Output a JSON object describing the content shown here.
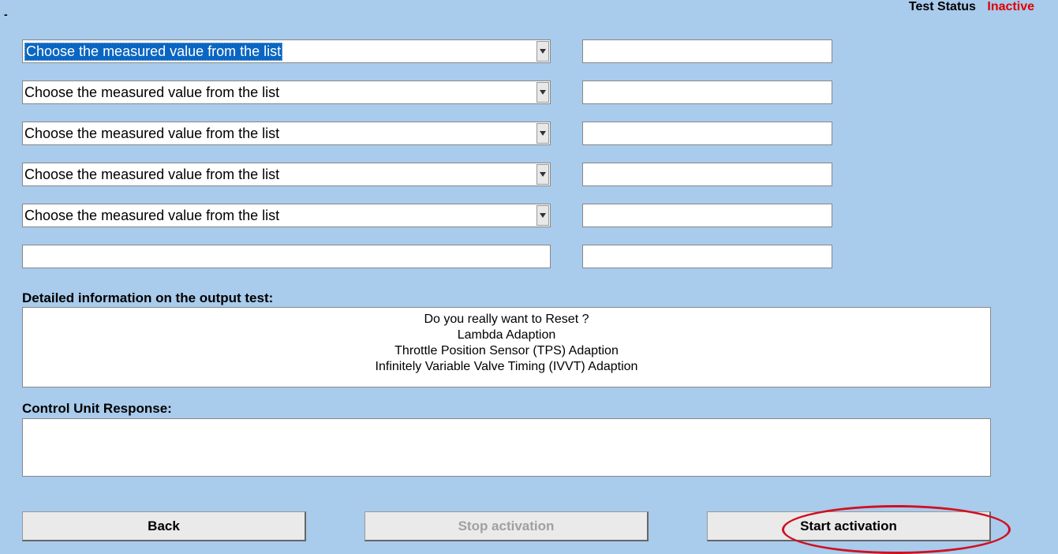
{
  "status": {
    "label": "Test Status",
    "value": "Inactive"
  },
  "dash": "-",
  "select_placeholder": "Choose the measured value from the list",
  "rows": [
    {
      "selected": "Choose the measured value from the list",
      "value": "",
      "highlighted": true
    },
    {
      "selected": "Choose the measured value from the list",
      "value": "",
      "highlighted": false
    },
    {
      "selected": "Choose the measured value from the list",
      "value": "",
      "highlighted": false
    },
    {
      "selected": "Choose the measured value from the list",
      "value": "",
      "highlighted": false
    },
    {
      "selected": "Choose the measured value from the list",
      "value": "",
      "highlighted": false
    }
  ],
  "free_text": "",
  "free_value": "",
  "labels": {
    "details": "Detailed information on the output test:",
    "response": "Control Unit Response:"
  },
  "details": {
    "line1": "Do you really want to Reset ?",
    "line2": "Lambda Adaption",
    "line3": "Throttle Position Sensor (TPS) Adaption",
    "line4": "Infinitely Variable Valve Timing (IVVT) Adaption"
  },
  "response_text": "",
  "buttons": {
    "back": "Back",
    "stop": "Stop activation",
    "start": "Start activation"
  }
}
